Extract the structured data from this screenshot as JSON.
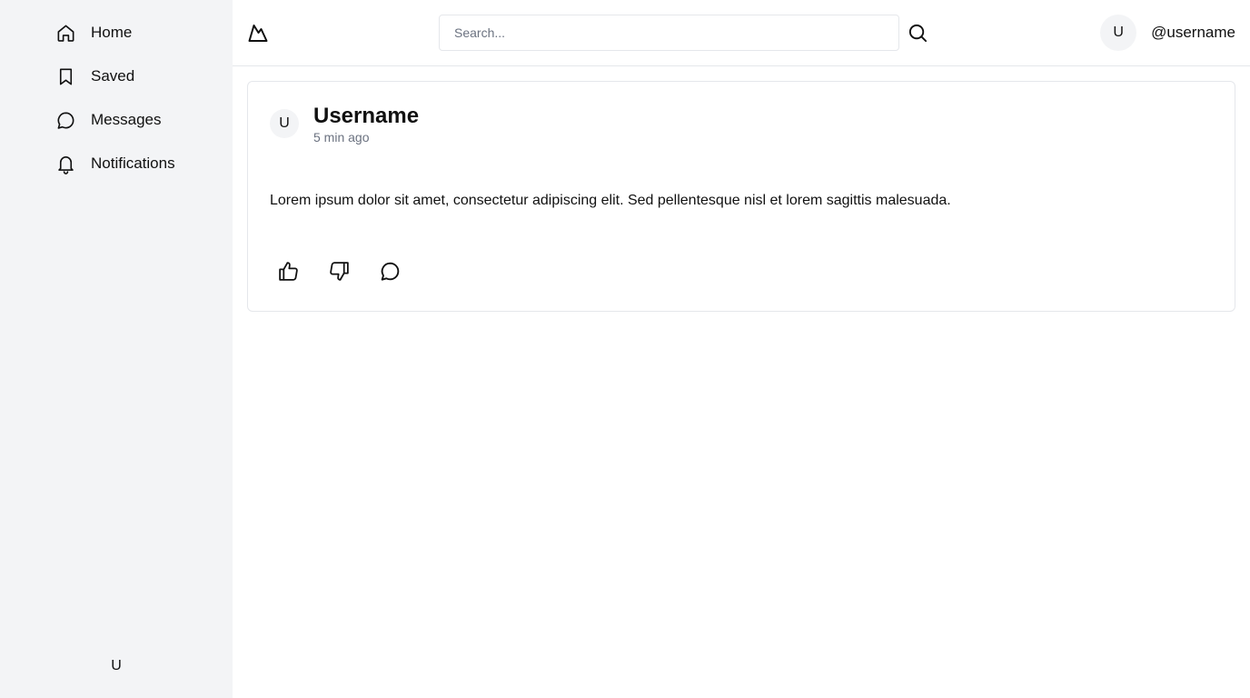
{
  "sidebar": {
    "items": [
      {
        "label": "Home",
        "icon": "home-icon"
      },
      {
        "label": "Saved",
        "icon": "bookmark-icon"
      },
      {
        "label": "Messages",
        "icon": "message-icon"
      },
      {
        "label": "Notifications",
        "icon": "bell-icon"
      }
    ],
    "user_initial": "U"
  },
  "header": {
    "logo_icon": "mountain-logo-icon",
    "search": {
      "placeholder": "Search...",
      "value": ""
    },
    "user": {
      "avatar_initial": "U",
      "handle": "@username"
    }
  },
  "post": {
    "avatar_initial": "U",
    "author": "Username",
    "time": "5 min ago",
    "body": "Lorem ipsum dolor sit amet, consectetur adipiscing elit. Sed pellentesque nisl et lorem sagittis malesuada.",
    "actions": [
      "thumbs-up-icon",
      "thumbs-down-icon",
      "comment-icon"
    ]
  },
  "colors": {
    "sidebar_bg": "#f3f4f6",
    "border": "#e5e7eb",
    "muted_text": "#6b7280",
    "text": "#111111"
  }
}
